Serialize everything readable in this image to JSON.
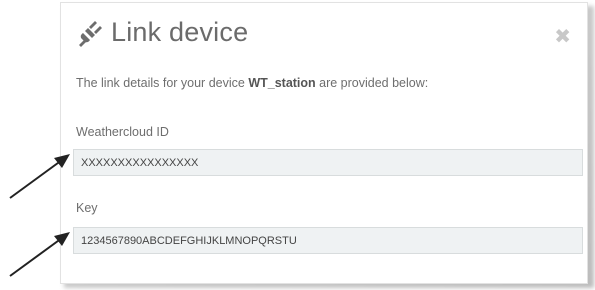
{
  "dialog": {
    "title": "Link device",
    "close_icon": "close-icon",
    "header_icon": "plug-icon",
    "description_prefix": "The link details for your device ",
    "device_name": "WT_station",
    "description_suffix": " are provided below:"
  },
  "fields": {
    "weathercloud_id": {
      "label": "Weathercloud ID",
      "value": "XXXXXXXXXXXXXXXX"
    },
    "key": {
      "label": "Key",
      "value": "1234567890ABCDEFGHIJKLMNOPQRSTU"
    }
  },
  "colors": {
    "title": "#6b6b6b",
    "field_bg": "#eff2f3",
    "arrow": "#222222"
  }
}
